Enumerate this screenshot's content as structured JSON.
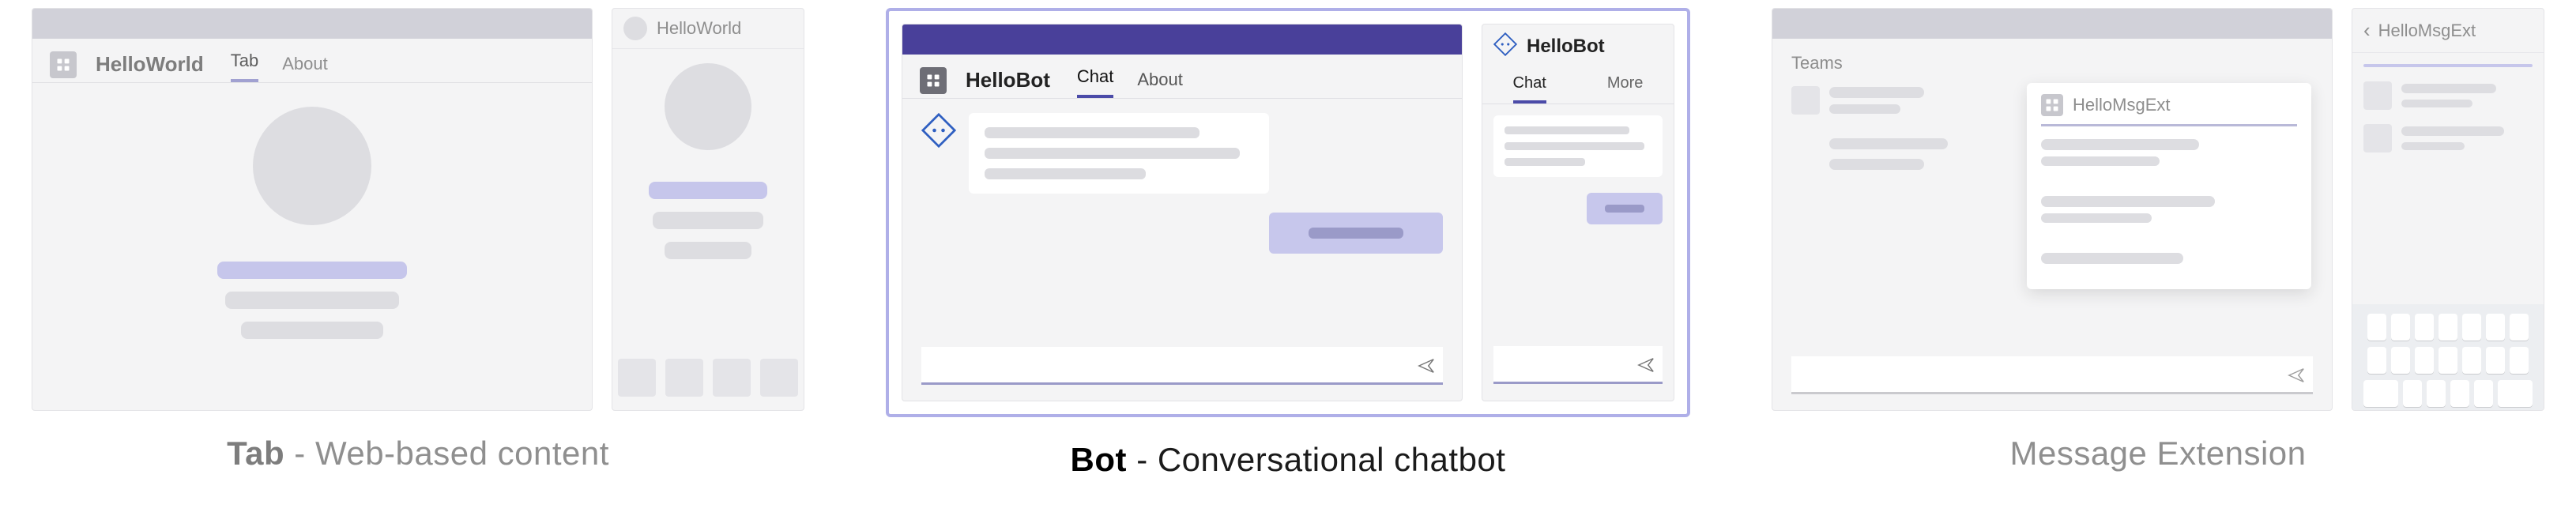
{
  "panels": {
    "tab": {
      "caption_bold": "Tab",
      "caption_rest": " - Web-based content",
      "desktop": {
        "app_name": "HelloWorld",
        "tabs": [
          "Tab",
          "About"
        ],
        "active_tab_index": 0
      },
      "mobile": {
        "app_name": "HelloWorld"
      }
    },
    "bot": {
      "caption_bold": "Bot",
      "caption_rest": " - Conversational chatbot",
      "desktop": {
        "app_name": "HelloBot",
        "tabs": [
          "Chat",
          "About"
        ],
        "active_tab_index": 0
      },
      "mobile": {
        "app_name": "HelloBot",
        "tabs": [
          "Chat",
          "More"
        ],
        "active_tab_index": 0
      }
    },
    "ext": {
      "caption": "Message Extension",
      "desktop": {
        "sidebar_label": "Teams",
        "popup_title": "HelloMsgExt"
      },
      "mobile": {
        "back_glyph": "‹",
        "title": "HelloMsgExt"
      }
    }
  },
  "colors": {
    "teams_purple": "#49409a",
    "accent": "#4b4ba8",
    "accent_light": "#c7c7ec",
    "skeleton": "#dcdce0"
  }
}
